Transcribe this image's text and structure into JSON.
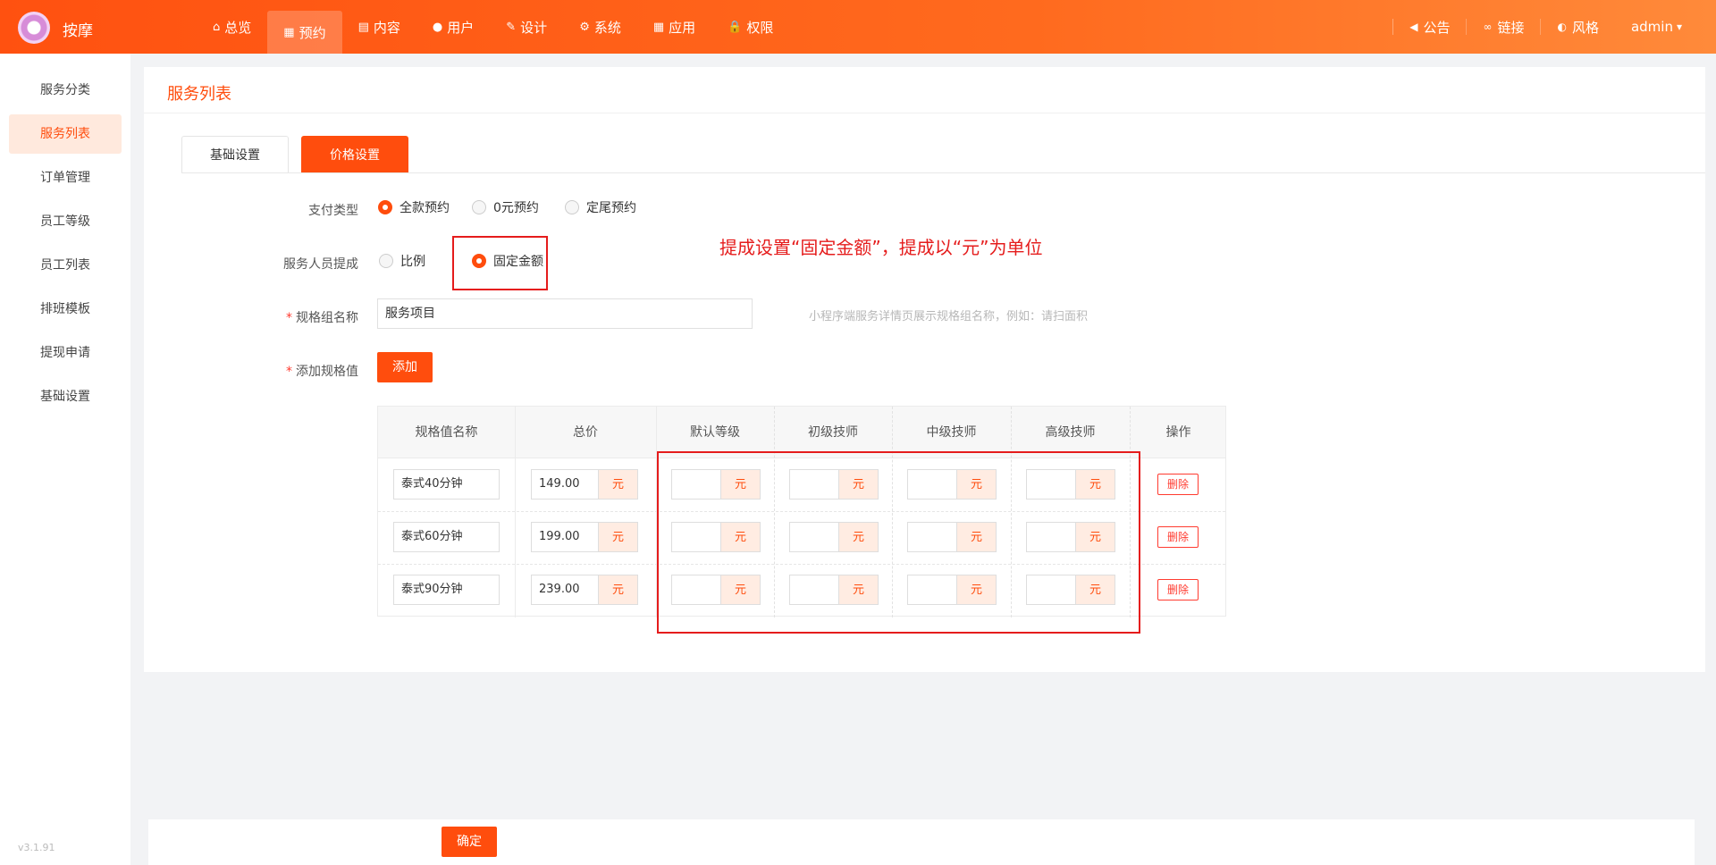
{
  "app": {
    "brand": "按摩",
    "version": "v3.1.91"
  },
  "nav": [
    {
      "label": "总览",
      "icon": "home-icon",
      "glyph": "⌂"
    },
    {
      "label": "预约",
      "icon": "calendar-icon",
      "glyph": "▦",
      "active": true
    },
    {
      "label": "内容",
      "icon": "document-icon",
      "glyph": "▤"
    },
    {
      "label": "用户",
      "icon": "user-icon",
      "glyph": "●"
    },
    {
      "label": "设计",
      "icon": "brush-icon",
      "glyph": "✎"
    },
    {
      "label": "系统",
      "icon": "gear-icon",
      "glyph": "⚙"
    },
    {
      "label": "应用",
      "icon": "grid-icon",
      "glyph": "▦"
    },
    {
      "label": "权限",
      "icon": "lock-icon",
      "glyph": "🔒"
    }
  ],
  "top_right": [
    {
      "label": "公告",
      "icon": "speaker-icon",
      "glyph": "◀"
    },
    {
      "label": "链接",
      "icon": "link-icon",
      "glyph": "∞"
    },
    {
      "label": "风格",
      "icon": "palette-icon",
      "glyph": "◐"
    },
    {
      "label": "admin",
      "icon": "chevron-down-icon",
      "glyph": "▾"
    }
  ],
  "sidebar": [
    {
      "label": "服务分类"
    },
    {
      "label": "服务列表",
      "active": true
    },
    {
      "label": "订单管理"
    },
    {
      "label": "员工等级"
    },
    {
      "label": "员工列表"
    },
    {
      "label": "排班模板"
    },
    {
      "label": "提现申请"
    },
    {
      "label": "基础设置"
    }
  ],
  "page": {
    "title": "服务列表"
  },
  "tabs": [
    {
      "label": "基础设置"
    },
    {
      "label": "价格设置",
      "active": true
    }
  ],
  "form": {
    "payment_type": {
      "label": "支付类型",
      "options": [
        {
          "label": "全款预约",
          "selected": true
        },
        {
          "label": "0元预约"
        },
        {
          "label": "定尾预约"
        }
      ]
    },
    "commission": {
      "label": "服务人员提成",
      "options": [
        {
          "label": "比例"
        },
        {
          "label": "固定金额",
          "selected": true
        }
      ]
    },
    "spec_group": {
      "label": "规格组名称",
      "required_mark": "*",
      "value": "服务项目",
      "hint": "小程序端服务详情页展示规格组名称，例如：请扫面积"
    },
    "add_spec": {
      "label": "添加规格值",
      "required_mark": "*",
      "button": "添加"
    }
  },
  "annotation": "提成设置“固定金额”，提成以“元”为单位",
  "table": {
    "columns": [
      "规格值名称",
      "总价",
      "默认等级",
      "初级技师",
      "中级技师",
      "高级技师",
      "操作"
    ],
    "unit": "元",
    "delete_label": "删除",
    "rows": [
      {
        "name": "泰式40分钟",
        "price": "149.00"
      },
      {
        "name": "泰式60分钟",
        "price": "199.00"
      },
      {
        "name": "泰式90分钟",
        "price": "239.00"
      }
    ]
  },
  "footer": {
    "confirm": "确定"
  },
  "colors": {
    "accent": "#ff4d0d",
    "annotation": "#e51c1c"
  }
}
